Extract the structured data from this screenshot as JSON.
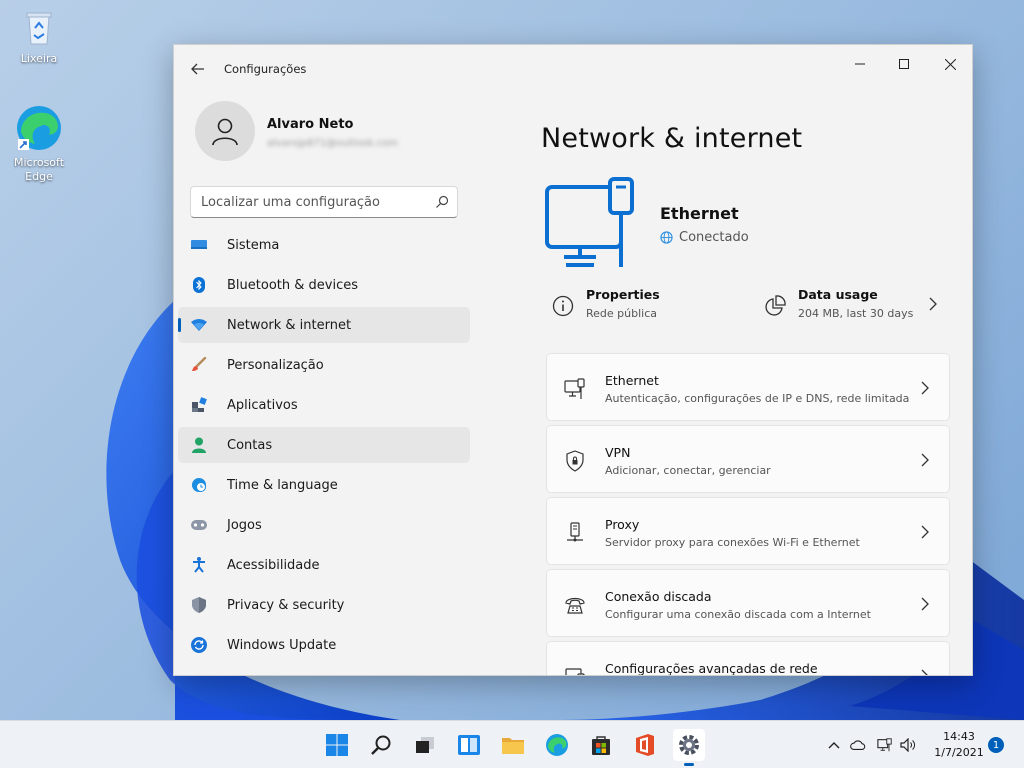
{
  "desktop": {
    "icons": [
      {
        "label": "Lixeira",
        "icon": "recycle-bin-icon"
      },
      {
        "label": "Microsoft Edge",
        "icon": "edge-icon"
      }
    ]
  },
  "window": {
    "title": "Configurações",
    "controls": [
      "minimize-icon",
      "maximize-icon",
      "close-icon"
    ]
  },
  "profile": {
    "name": "Alvaro Neto",
    "email": "alvarojp871@outlook.com"
  },
  "search": {
    "placeholder": "Localizar uma configuração"
  },
  "sidebar": {
    "items": [
      {
        "label": "Sistema",
        "icon": "system-icon"
      },
      {
        "label": "Bluetooth & devices",
        "icon": "bluetooth-icon"
      },
      {
        "label": "Network & internet",
        "icon": "wifi-icon",
        "selected": true
      },
      {
        "label": "Personalização",
        "icon": "brush-icon"
      },
      {
        "label": "Aplicativos",
        "icon": "apps-icon"
      },
      {
        "label": "Contas",
        "icon": "account-icon"
      },
      {
        "label": "Time & language",
        "icon": "clock-globe-icon"
      },
      {
        "label": "Jogos",
        "icon": "gamepad-icon"
      },
      {
        "label": "Acessibilidade",
        "icon": "accessibility-icon"
      },
      {
        "label": "Privacy & security",
        "icon": "shield-icon"
      },
      {
        "label": "Windows Update",
        "icon": "update-icon"
      }
    ]
  },
  "main": {
    "title": "Network & internet",
    "hero": {
      "name": "Ethernet",
      "status": "Conectado"
    },
    "quick": {
      "properties": {
        "title": "Properties",
        "subtitle": "Rede pública"
      },
      "data_usage": {
        "title": "Data usage",
        "subtitle": "204 MB, last 30 days"
      }
    },
    "cards": [
      {
        "title": "Ethernet",
        "subtitle": "Autenticação, configurações de IP e DNS, rede limitada",
        "icon": "ethernet-icon"
      },
      {
        "title": "VPN",
        "subtitle": "Adicionar, conectar, gerenciar",
        "icon": "vpn-shield-icon"
      },
      {
        "title": "Proxy",
        "subtitle": "Servidor proxy para conexões Wi-Fi e Ethernet",
        "icon": "proxy-icon"
      },
      {
        "title": "Conexão discada",
        "subtitle": "Configurar uma conexão discada com a Internet",
        "icon": "dialup-icon"
      },
      {
        "title": "Configurações avançadas de rede",
        "subtitle": "",
        "icon": "monitor-icon"
      }
    ]
  },
  "taskbar": {
    "time": "14:43",
    "date": "1/7/2021",
    "notification_count": "1"
  },
  "colors": {
    "accent": "#005fb8",
    "hero_blue": "#0078d4"
  }
}
